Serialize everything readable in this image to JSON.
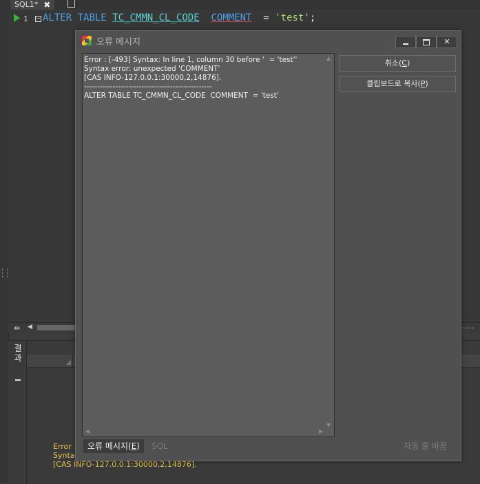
{
  "editor": {
    "tab_label": "SQL1*",
    "tab_close": "✖",
    "line_number": "1",
    "fold_marker": "−",
    "code_tokens": {
      "kw1": "ALTER",
      "kw2": "TABLE",
      "table": "TC_CMMN_CL_CODE",
      "column": "COMMENT",
      "op": "=",
      "value": "'test'",
      "semi": ";"
    }
  },
  "result_panel": {
    "tab_label": "결과",
    "log_lines": "Error : \nSyntax\n[CAS INFO-127.0.0.1:30000,2,14876]."
  },
  "dialog": {
    "title": "오류 메시지",
    "message": "Error : [-493] Syntax: In line 1, column 30 before '  = 'test''\nSyntax error: unexpected 'COMMENT'\n[CAS INFO-127.0.0.1:30000,2,14876].\n-------------------------------------------------\nALTER TABLE TC_CMMN_CL_CODE  COMMENT  = 'test'",
    "cancel_label": "취소(",
    "cancel_key": "C",
    "cancel_close": ")",
    "copy_label": "클립보드로 복사(",
    "copy_key": "P",
    "copy_close": ")",
    "tabs": {
      "error_label": "오류 메시지(",
      "error_key": "E",
      "error_close": ")",
      "sql_label": "SQL"
    },
    "word_wrap_label": "자동 줄 바꿈"
  },
  "colors": {
    "keyword": "#4c9fe4",
    "table_name": "#5ecfcf",
    "string": "#a6d56b",
    "log_text": "#e8c34a",
    "run_arrow": "#3bb33b"
  }
}
